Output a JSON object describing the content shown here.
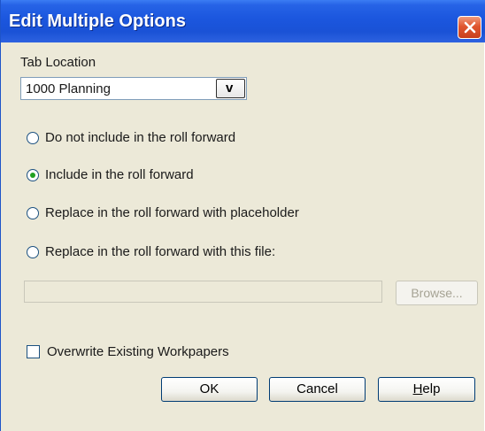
{
  "window": {
    "title": "Edit Multiple Options",
    "close_icon": "close-icon"
  },
  "tab_location": {
    "label": "Tab Location",
    "selected": "1000 Planning",
    "dropdown_glyph": "v"
  },
  "options": [
    {
      "label": "Do not include in the roll forward",
      "checked": false
    },
    {
      "label": "Include in the roll forward",
      "checked": true
    },
    {
      "label": "Replace in the roll forward with placeholder",
      "checked": false
    },
    {
      "label": "Replace in the roll forward with this file:",
      "checked": false
    }
  ],
  "file": {
    "value": "",
    "browse_label": "Browse..."
  },
  "overwrite": {
    "label": "Overwrite Existing Workpapers",
    "checked": false
  },
  "buttons": {
    "ok": "OK",
    "cancel": "Cancel",
    "help": "Help"
  },
  "colors": {
    "titlebar": "#1a52d6",
    "dialog_bg": "#ECE9D8",
    "radio_selected": "#21a121",
    "close_button": "#e0562f"
  }
}
